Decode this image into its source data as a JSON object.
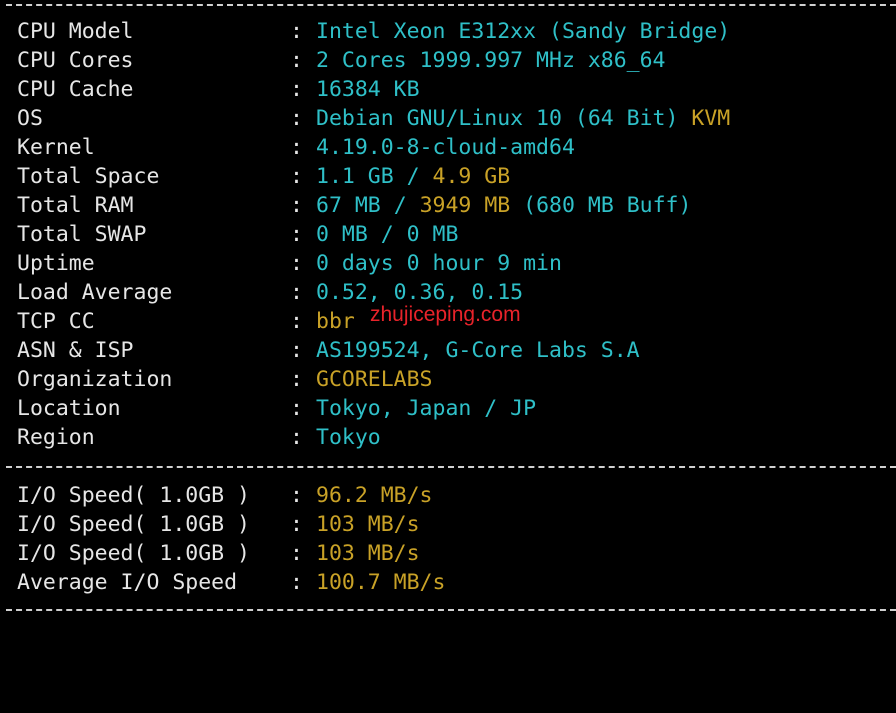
{
  "colors": {
    "background": "#000000",
    "label": "#e6e6e6",
    "cyan_value": "#2fc0c8",
    "gold_value": "#c9a227",
    "watermark": "#e8232a"
  },
  "system_info": {
    "cpu_model": {
      "label": "CPU Model",
      "sep": ":",
      "value": "Intel Xeon E312xx (Sandy Bridge)"
    },
    "cpu_cores": {
      "label": "CPU Cores",
      "sep": ":",
      "value": "2 Cores 1999.997 MHz x86_64"
    },
    "cpu_cache": {
      "label": "CPU Cache",
      "sep": ":",
      "value": "16384 KB"
    },
    "os": {
      "label": "OS",
      "sep": ":",
      "value_main": "Debian GNU/Linux 10 (64 Bit)",
      "value_virt": "KVM"
    },
    "kernel": {
      "label": "Kernel",
      "sep": ":",
      "value": "4.19.0-8-cloud-amd64"
    },
    "total_space": {
      "label": "Total Space",
      "sep": ":",
      "used": "1.1 GB",
      "slash": "/",
      "total": "4.9 GB"
    },
    "total_ram": {
      "label": "Total RAM",
      "sep": ":",
      "used": "67 MB",
      "slash": "/",
      "total": "3949 MB",
      "buff": "(680 MB Buff)"
    },
    "total_swap": {
      "label": "Total SWAP",
      "sep": ":",
      "value": "0 MB / 0 MB"
    },
    "uptime": {
      "label": "Uptime",
      "sep": ":",
      "value": "0 days 0 hour 9 min"
    },
    "load_average": {
      "label": "Load Average",
      "sep": ":",
      "value": "0.52, 0.36, 0.15"
    },
    "tcp_cc": {
      "label": "TCP CC",
      "sep": ":",
      "value": "bbr"
    },
    "asn_isp": {
      "label": "ASN & ISP",
      "sep": ":",
      "value": "AS199524, G-Core Labs S.A"
    },
    "organization": {
      "label": "Organization",
      "sep": ":",
      "value": "GCORELABS"
    },
    "location": {
      "label": "Location",
      "sep": ":",
      "value": "Tokyo, Japan / JP"
    },
    "region": {
      "label": "Region",
      "sep": ":",
      "value": "Tokyo"
    }
  },
  "io_speed": {
    "run1": {
      "label": "I/O Speed( 1.0GB )",
      "sep": ":",
      "value": "96.2 MB/s"
    },
    "run2": {
      "label": "I/O Speed( 1.0GB )",
      "sep": ":",
      "value": "103 MB/s"
    },
    "run3": {
      "label": "I/O Speed( 1.0GB )",
      "sep": ":",
      "value": "103 MB/s"
    },
    "average": {
      "label": "Average I/O Speed",
      "sep": ":",
      "value": "100.7 MB/s"
    }
  },
  "watermark": {
    "text": "zhujiceping.com"
  }
}
